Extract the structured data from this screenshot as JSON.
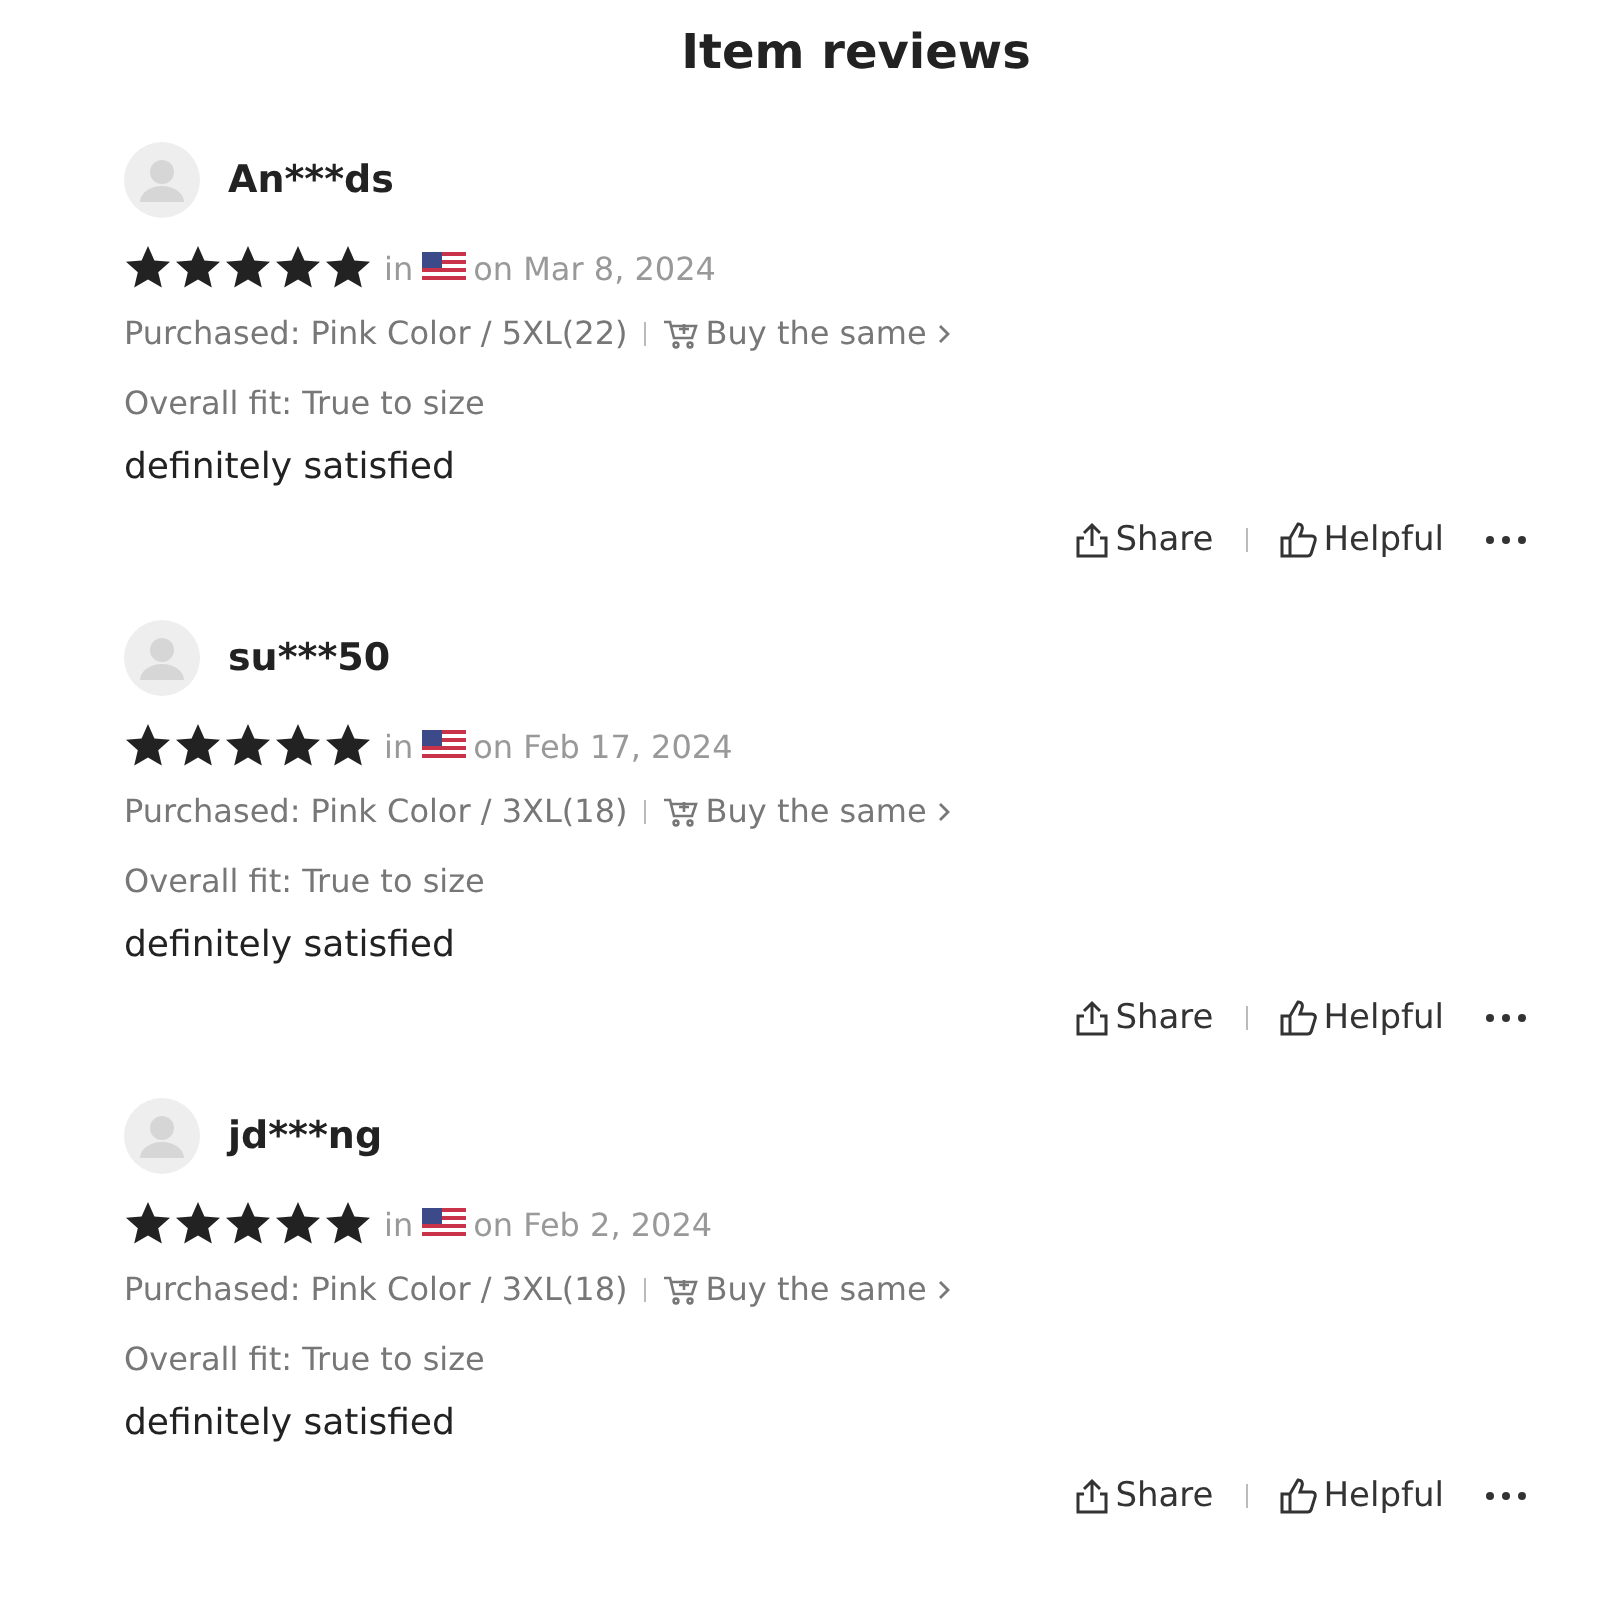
{
  "title": "Item reviews",
  "reviews": [
    {
      "user": "An***ds",
      "stars": 5,
      "in": "in",
      "date": "on Mar 8, 2024",
      "purchased": "Purchased: Pink Color / 5XL(22)",
      "buy": "Buy the same",
      "fit": "Overall fit: True to size",
      "text": "definitely satisfied",
      "share": "Share",
      "helpful": "Helpful"
    },
    {
      "user": "su***50",
      "stars": 5,
      "in": "in",
      "date": "on Feb 17, 2024",
      "purchased": "Purchased: Pink Color / 3XL(18)",
      "buy": "Buy the same",
      "fit": "Overall fit: True to size",
      "text": "definitely satisfied",
      "share": "Share",
      "helpful": "Helpful"
    },
    {
      "user": "jd***ng",
      "stars": 5,
      "in": "in",
      "date": "on Feb 2, 2024",
      "purchased": "Purchased: Pink Color / 3XL(18)",
      "buy": "Buy the same",
      "fit": "Overall fit: True to size",
      "text": "definitely satisfied",
      "share": "Share",
      "helpful": "Helpful"
    }
  ]
}
